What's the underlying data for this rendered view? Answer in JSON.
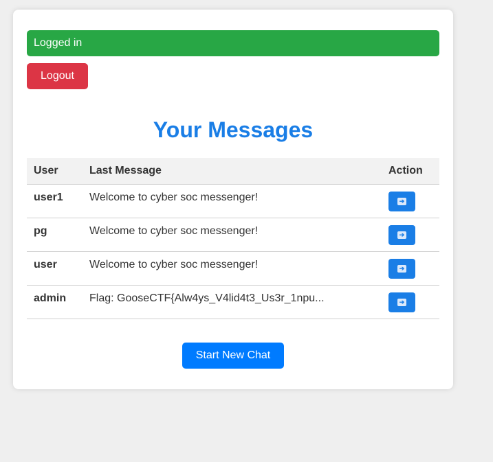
{
  "status": {
    "text": "Logged in",
    "color": "#28a745"
  },
  "logout_label": "Logout",
  "title": "Your Messages",
  "table": {
    "headers": [
      "User",
      "Last Message",
      "Action"
    ],
    "rows": [
      {
        "user": "user1",
        "message": "Welcome to cyber soc messenger!",
        "action_icon": "arrow-right-icon"
      },
      {
        "user": "pg",
        "message": "Welcome to cyber soc messenger!",
        "action_icon": "arrow-right-icon"
      },
      {
        "user": "user",
        "message": "Welcome to cyber soc messenger!",
        "action_icon": "arrow-right-icon"
      },
      {
        "user": "admin",
        "message": "Flag: GooseCTF{Alw4ys_V4lid4t3_Us3r_1npu...",
        "action_icon": "arrow-right-icon"
      }
    ]
  },
  "start_chat_label": "Start New Chat",
  "colors": {
    "accent": "#007bff",
    "title": "#1a7ee6",
    "danger": "#dc3545",
    "success": "#28a745",
    "background": "#efefef"
  }
}
